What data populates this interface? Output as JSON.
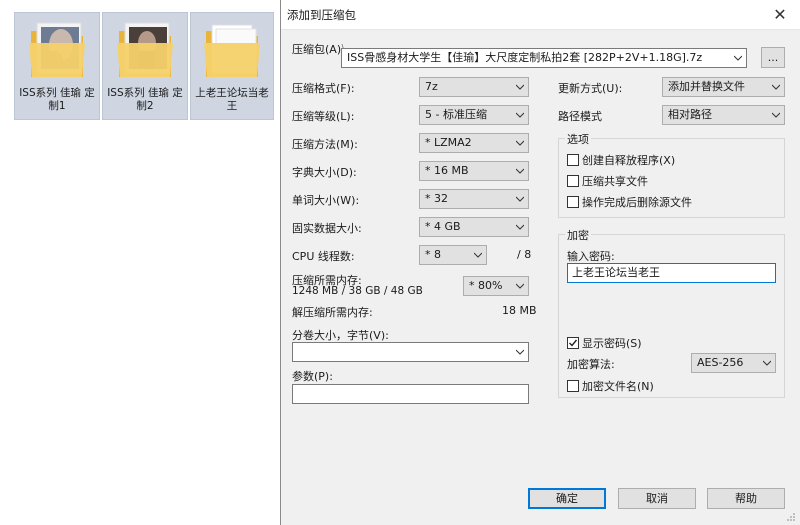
{
  "desktop": {
    "files": [
      {
        "name": "ISS系列  佳瑜 定制1"
      },
      {
        "name": "ISS系列  佳瑜 定制2"
      },
      {
        "name": "上老王论坛当老王"
      }
    ]
  },
  "dialog": {
    "title": "添加到压缩包",
    "archive_label": "压缩包(A)",
    "archive_path_partial": "\\",
    "archive_name": "ISS骨感身材大学生【佳瑜】大尺度定制私拍2套 [282P+2V+1.18G].7z",
    "browse_label": "...",
    "format_label": "压缩格式(F):",
    "format_value": "7z",
    "level_label": "压缩等级(L):",
    "level_value": "5 - 标准压缩",
    "method_label": "压缩方法(M):",
    "method_value": "* LZMA2",
    "dict_label": "字典大小(D):",
    "dict_value": "* 16 MB",
    "word_label": "单词大小(W):",
    "word_value": "* 32",
    "solid_label": "固实数据大小:",
    "solid_value": "* 4 GB",
    "cpu_label": "CPU 线程数:",
    "cpu_value": "* 8",
    "cpu_total": "/ 8",
    "mem_comp_label": "压缩所需内存:",
    "mem_comp_value": "1248 MB / 38 GB / 48 GB",
    "mem_percent": "* 80%",
    "mem_decomp_label": "解压缩所需内存:",
    "mem_decomp_value": "18 MB",
    "volume_label": "分卷大小，字节(V):",
    "volume_value": "",
    "params_label": "参数(P):",
    "params_value": "",
    "update_label": "更新方式(U):",
    "update_value": "添加并替换文件",
    "pathmode_label": "路径模式",
    "pathmode_value": "相对路径",
    "options_title": "选项",
    "opt_sfx": "创建自释放程序(X)",
    "opt_shared": "压缩共享文件",
    "opt_delete": "操作完成后删除源文件",
    "encrypt_title": "加密",
    "password_label": "输入密码:",
    "password_value": "上老王论坛当老王",
    "show_password": "显示密码(S)",
    "enc_method_label": "加密算法:",
    "enc_method_value": "AES-256",
    "enc_names": "加密文件名(N)",
    "ok": "确定",
    "cancel": "取消",
    "help": "帮助"
  },
  "colors": {
    "accent": "#0078d7",
    "dialog_bg": "#f0f0f0",
    "folder_yellow": "#f2c84b"
  }
}
